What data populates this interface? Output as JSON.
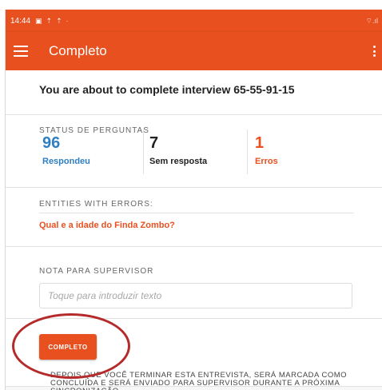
{
  "statusbar": {
    "time": "14:44",
    "icons": [
      "image-icon",
      "upload-icon",
      "upload-icon",
      "dot-icon"
    ],
    "icons_glyphs": [
      "▣",
      "⇡",
      "⇡",
      "·"
    ],
    "signal": "⌔.ıl"
  },
  "appbar": {
    "title": "Completo"
  },
  "summary": {
    "heading": "You are about to complete interview 65-55-91-15"
  },
  "status": {
    "caption": "STATUS DE PERGUNTAS",
    "answered": {
      "count": "96",
      "label": "Respondeu",
      "color": "#2f7fc1"
    },
    "unanswered": {
      "count": "7",
      "label": "Sem resposta",
      "color": "#222222"
    },
    "errors": {
      "count": "1",
      "label": "Erros",
      "color": "#e8501f"
    }
  },
  "entities": {
    "caption": "ENTITIES WITH ERRORS:",
    "items": [
      {
        "label": "Qual e a idade do Finda Zombo?"
      }
    ]
  },
  "note": {
    "caption": "NOTA PARA SUPERVISOR",
    "placeholder": "Toque para introduzir texto"
  },
  "complete": {
    "button_label": "COMPLETO",
    "info": "Depois que você terminar esta entrevista, será marcada como concluída e será enviado para supervisor durante a próxima sincronização"
  },
  "colors": {
    "accent": "#e8501f",
    "annotation": "#b52a2a"
  }
}
